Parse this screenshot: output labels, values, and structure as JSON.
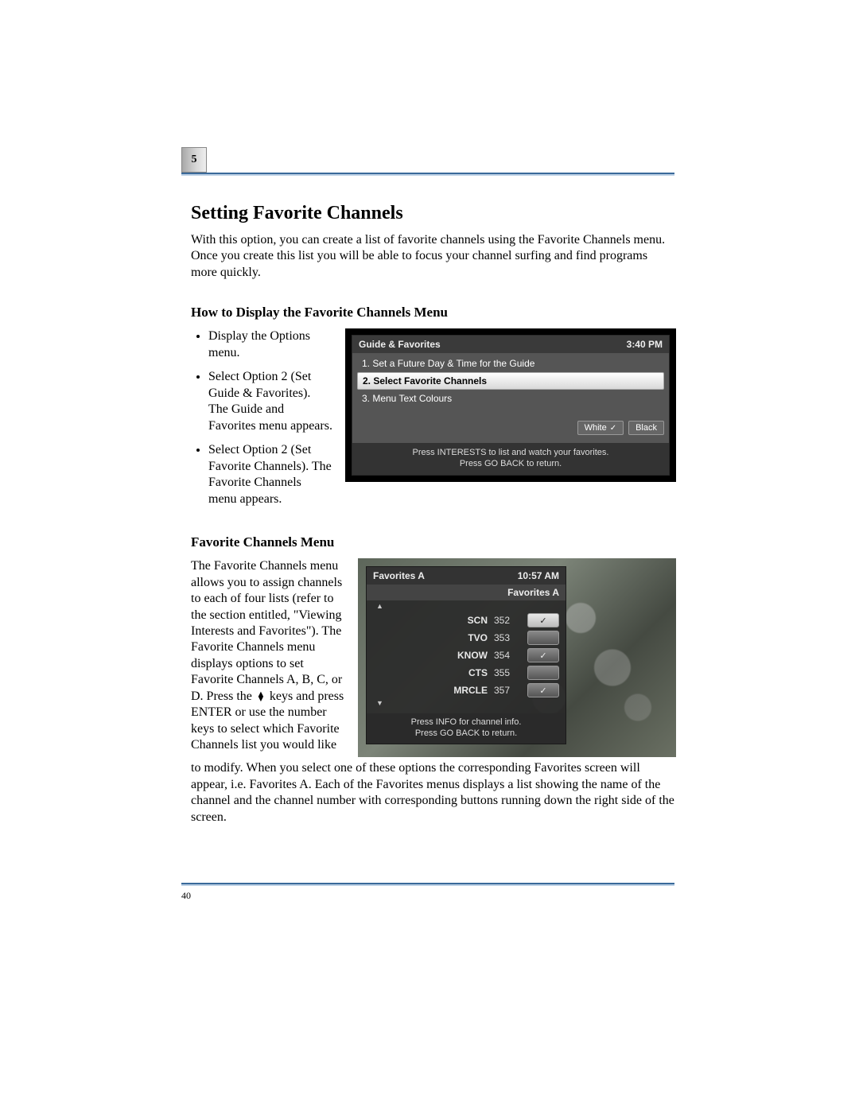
{
  "chapter_number": "5",
  "title": "Setting Favorite Channels",
  "intro": "With this option, you can create a list of favorite channels using the Favorite Channels menu. Once you create this list you will be able to focus your channel surfing and find programs more quickly.",
  "section1_heading": "How to Display the Favorite Channels Menu",
  "steps": [
    "Display the Options menu.",
    "Select Option 2 (Set Guide & Favorites). The Guide and Favorites menu appears.",
    "Select Option 2 (Set Favorite Channels). The Favorite Channels menu appears."
  ],
  "guide_menu": {
    "title": "Guide & Favorites",
    "time": "3:40 PM",
    "items": [
      "1.  Set a Future Day & Time for the Guide",
      "2.  Select Favorite Channels",
      "3.  Menu Text Colours"
    ],
    "selected_index": 1,
    "color_white": "White",
    "color_black": "Black",
    "footer_line1": "Press INTERESTS to list and watch your favorites.",
    "footer_line2": "Press GO BACK to return."
  },
  "section2_heading": "Favorite Channels Menu",
  "body2_before": "The Favorite Channels menu allows you to assign channels to each of four lists (refer to the section entitled, \"Viewing Interests and Favorites\"). The Favorite Channels menu displays options to set Favorite Channels A, B, C, or D. Press the",
  "body2_after_icon": "keys and press ENTER or use the number keys to select which Favorite Channels list you would like",
  "body2_continue": "to modify. When you select one of these options the corresponding Favorites screen will appear,  i.e. Favorites A. Each of the Favorites menus displays a list showing the name of the channel and the channel number with corresponding buttons running down the right side of the screen.",
  "fav_menu": {
    "title": "Favorites A",
    "time": "10:57 AM",
    "subhead": "Favorites A",
    "channels": [
      {
        "name": "SCN",
        "num": "352",
        "on": true
      },
      {
        "name": "TVO",
        "num": "353",
        "on": false
      },
      {
        "name": "KNOW",
        "num": "354",
        "on": true
      },
      {
        "name": "CTS",
        "num": "355",
        "on": false
      },
      {
        "name": "MRCLE",
        "num": "357",
        "on": true
      }
    ],
    "footer_line1": "Press INFO for channel info.",
    "footer_line2": "Press GO BACK to return."
  },
  "page_number": "40"
}
